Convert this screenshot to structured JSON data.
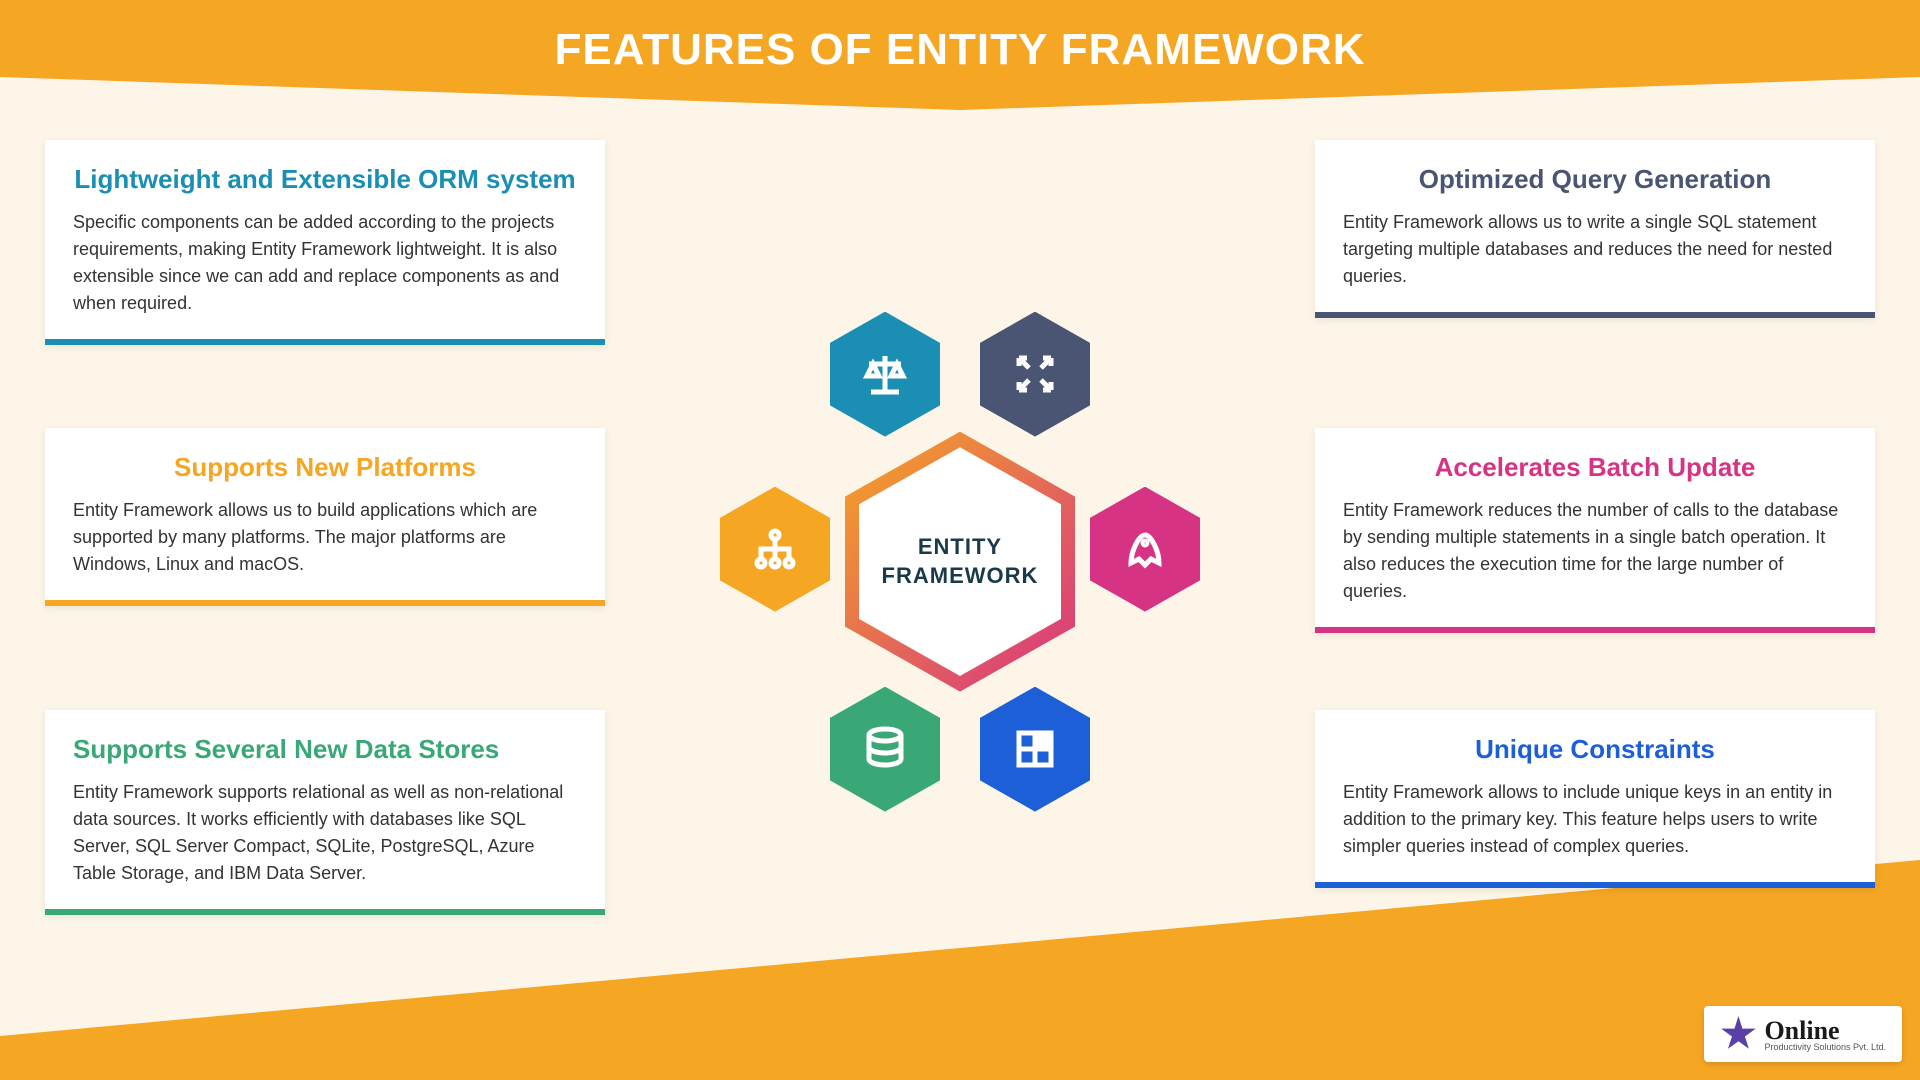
{
  "header": {
    "title": "FEATURES OF ENTITY FRAMEWORK"
  },
  "center": {
    "label": "ENTITY FRAMEWORK"
  },
  "cards": {
    "left": [
      {
        "title": "Lightweight and Extensible ORM system",
        "body": "Specific components can be added according to the projects requirements, making Entity Framework lightweight. It is also extensible since we can add and replace components as and when required."
      },
      {
        "title": "Supports New Platforms",
        "body": "Entity Framework allows us to build applications which are supported by many platforms. The major platforms are Windows, Linux and macOS."
      },
      {
        "title": "Supports Several New Data Stores",
        "body": "Entity Framework supports relational as well as non-relational data sources. It works efficiently with databases like SQL Server, SQL Server Compact, SQLite, PostgreSQL, Azure Table Storage, and IBM Data Server."
      }
    ],
    "right": [
      {
        "title": "Optimized Query Generation",
        "body": "Entity Framework allows us to write a single SQL statement targeting multiple databases and reduces the need for nested queries."
      },
      {
        "title": "Accelerates Batch Update",
        "body": "Entity Framework reduces the number of calls to the database by sending multiple statements in a single batch operation. It also reduces the execution time for the large number of queries."
      },
      {
        "title": "Unique Constraints",
        "body": "Entity Framework allows to include unique keys in an entity in addition to the primary key. This feature helps users to write simpler queries instead of complex queries."
      }
    ]
  },
  "hex_icons": {
    "top_left": "scales-icon",
    "top_right": "expand-icon",
    "mid_left": "hierarchy-icon",
    "mid_right": "rocket-icon",
    "bot_left": "database-icon",
    "bot_right": "grid-icon"
  },
  "logo": {
    "brand": "Online",
    "subtitle": "Productivity Solutions Pvt. Ltd."
  },
  "colors": {
    "teal": "#1b8fb3",
    "orange": "#f5a623",
    "green": "#3aa876",
    "slate": "#4a5573",
    "pink": "#d63384",
    "blue": "#1d5fd6"
  }
}
